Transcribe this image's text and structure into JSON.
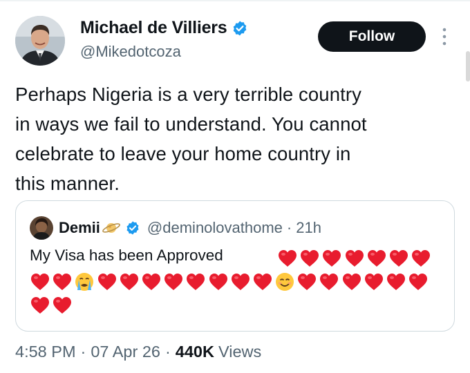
{
  "author": {
    "display_name": "Michael de Villiers",
    "handle": "@Mikedotcoza",
    "verified": true,
    "avatar": "profile-photo-man-in-suit"
  },
  "follow_button": {
    "label": "Follow"
  },
  "more_icon": "vertical-ellipsis-icon",
  "tweet": {
    "lines": [
      "Perhaps Nigeria is a very terrible country",
      "in ways we fail to understand. You cannot",
      "celebrate to leave your home country in",
      "this manner."
    ]
  },
  "quote": {
    "display_name": "Demii",
    "name_emoji": "ringed-planet",
    "verified": true,
    "handle": "@deminolovathome",
    "separator": "·",
    "time": "21h",
    "text": "My Visa has been Approved",
    "emoji_lines": [
      [
        "heart",
        "heart",
        "heart",
        "heart",
        "heart",
        "heart",
        "heart"
      ],
      [
        "heart",
        "heart",
        "crying",
        "heart",
        "heart",
        "heart",
        "heart",
        "heart",
        "heart",
        "heart",
        "heart",
        "smiling",
        "heart",
        "heart",
        "heart",
        "heart",
        "heart",
        "heart"
      ],
      [
        "heart",
        "heart"
      ]
    ]
  },
  "meta": {
    "time": "4:58 PM",
    "separator": "·",
    "date": "07 Apr 26",
    "views_count": "440K",
    "views_label": "Views"
  },
  "colors": {
    "text_primary": "#0f1419",
    "text_secondary": "#536471",
    "verified_blue": "#1d9bf0",
    "border": "#cfd9de",
    "heart_red": "#e81c2e",
    "follow_bg": "#0f1419"
  }
}
